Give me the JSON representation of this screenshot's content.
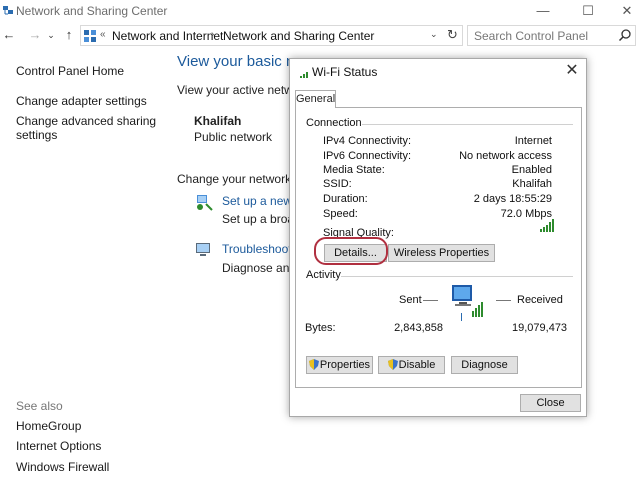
{
  "window": {
    "title": "Network and Sharing Center",
    "min_glyph": "—",
    "max_glyph": "☐",
    "close_glyph": "✕"
  },
  "nav": {
    "back_glyph": "←",
    "forward_glyph": "→",
    "recent_glyph": "⌄",
    "up_glyph": "↑",
    "crumb_sep": "«",
    "breadcrumbs": [
      "Network and Internet",
      "Network and Sharing Center"
    ],
    "breadcrumb_arrow": "›",
    "dropdown_glyph": "⌄",
    "refresh_glyph": "↻",
    "search_placeholder": "Search Control Panel"
  },
  "left_pane": {
    "home": "Control Panel Home",
    "links": [
      "Change adapter settings",
      "Change advanced sharing",
      "settings"
    ],
    "see_also_label": "See also",
    "see_also": [
      "HomeGroup",
      "Internet Options",
      "Windows Firewall"
    ]
  },
  "main": {
    "heading": "View your basic ne",
    "active_networks_label": "View your active networks",
    "network_name": "Khalifah",
    "network_type": "Public network",
    "change_label": "Change your networking",
    "task1_link": "Set up a new co",
    "task1_desc": "Set up a broadb",
    "task2_link": "Troubleshoot p",
    "task2_desc": "Diagnose and r"
  },
  "dialog": {
    "title": "Wi-Fi Status",
    "close_glyph": "✕",
    "tab": "General",
    "connection_group": "Connection",
    "rows": [
      {
        "label": "IPv4 Connectivity:",
        "value": "Internet"
      },
      {
        "label": "IPv6 Connectivity:",
        "value": "No network access"
      },
      {
        "label": "Media State:",
        "value": "Enabled"
      },
      {
        "label": "SSID:",
        "value": "Khalifah"
      },
      {
        "label": "Duration:",
        "value": "2 days 18:55:29"
      },
      {
        "label": "Speed:",
        "value": "72.0 Mbps"
      }
    ],
    "signal_quality_label": "Signal Quality:",
    "signal_bars": 5,
    "details_button": "Details...",
    "wireless_properties_button": "Wireless Properties",
    "activity_group": "Activity",
    "sent_label": "Sent",
    "received_label": "Received",
    "bytes_label": "Bytes:",
    "bytes_sent": "2,843,858",
    "bytes_received": "19,079,473",
    "properties_button": "Properties",
    "disable_button": "Disable",
    "diagnose_button": "Diagnose",
    "close_button": "Close"
  },
  "colors": {
    "link": "#1c5a9b",
    "highlight_ring": "#b03040",
    "signal_green": "#2e8b2e"
  }
}
